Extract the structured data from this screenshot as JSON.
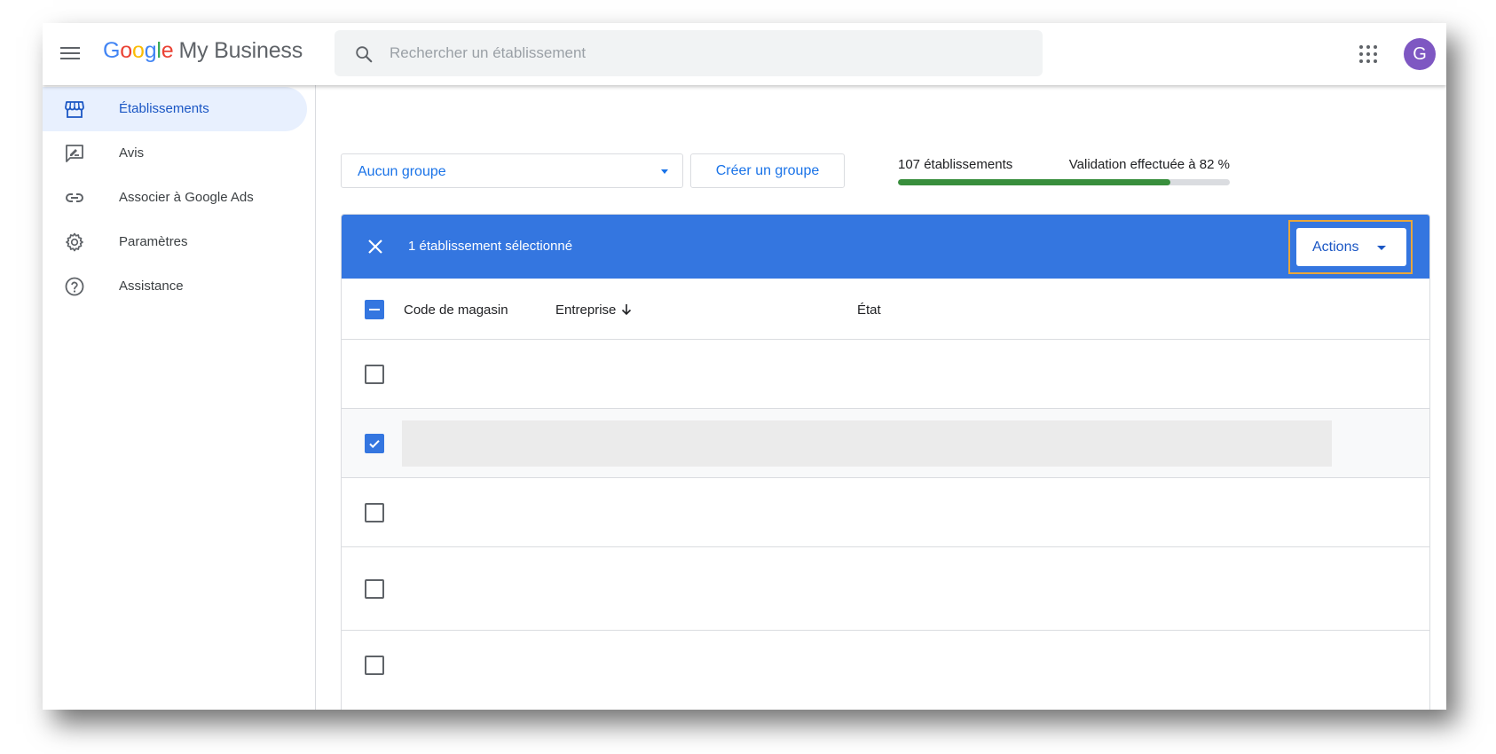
{
  "header": {
    "logo": {
      "brand_letters": [
        "G",
        "o",
        "o",
        "g",
        "l",
        "e"
      ],
      "product": "My Business"
    },
    "search": {
      "placeholder": "Rechercher un établissement",
      "value": ""
    },
    "avatar_initial": "G",
    "icons": {
      "menu": "hamburger-menu-icon",
      "search": "search-icon",
      "apps": "apps-grid-icon"
    }
  },
  "sidebar": {
    "items": [
      {
        "label": "Établissements",
        "icon": "storefront-icon",
        "active": true
      },
      {
        "label": "Avis",
        "icon": "review-icon",
        "active": false
      },
      {
        "label": "Associer à Google Ads",
        "icon": "link-icon",
        "active": false
      },
      {
        "label": "Paramètres",
        "icon": "gear-icon",
        "active": false
      },
      {
        "label": "Assistance",
        "icon": "help-icon",
        "active": false
      }
    ]
  },
  "toolbar": {
    "group_select_value": "Aucun groupe",
    "create_group_label": "Créer un groupe",
    "count_text": "107 établissements",
    "validation_text": "Validation effectuée à 82 %",
    "validation_percent": 82
  },
  "selection_bar": {
    "text": "1 établissement sélectionné",
    "actions_label": "Actions",
    "color": "#3476e0",
    "highlight_color": "#e9a63a"
  },
  "table": {
    "columns": [
      {
        "label": "Code de magasin"
      },
      {
        "label": "Entreprise",
        "sorted": "desc"
      },
      {
        "label": "État"
      }
    ],
    "header_checkbox": "indeterminate",
    "rows": [
      {
        "checked": false
      },
      {
        "checked": true
      },
      {
        "checked": false
      },
      {
        "checked": false
      },
      {
        "checked": false
      }
    ]
  }
}
